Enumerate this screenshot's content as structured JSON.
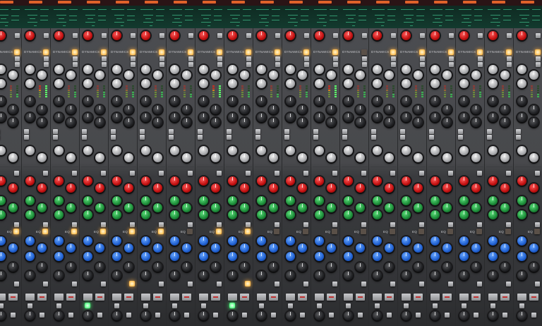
{
  "labels": {
    "dynamics": "DYNAMICS",
    "eq": "EQ"
  },
  "colors": {
    "accent_orange": "#e0622a",
    "display_green": "#3fbf8a",
    "led_amber": "#ffc35a",
    "led_green": "#5cff8a"
  },
  "channels": [
    {
      "dyn_on": true,
      "meter_level": 0.3,
      "eq_on": true,
      "sel_on": false,
      "aux_on": false
    },
    {
      "dyn_on": true,
      "meter_level": 1.0,
      "eq_on": true,
      "sel_on": false,
      "aux_on": false
    },
    {
      "dyn_on": true,
      "meter_level": 0.4,
      "eq_on": true,
      "sel_on": false,
      "aux_on": false
    },
    {
      "dyn_on": true,
      "meter_level": 0.5,
      "eq_on": true,
      "sel_on": true,
      "aux_on": false
    },
    {
      "dyn_on": true,
      "meter_level": 0.4,
      "eq_on": true,
      "sel_on": false,
      "aux_on": true
    },
    {
      "dyn_on": true,
      "meter_level": 0.5,
      "eq_on": true,
      "sel_on": false,
      "aux_on": false
    },
    {
      "dyn_on": true,
      "meter_level": 0.3,
      "eq_on": false,
      "sel_on": false,
      "aux_on": false
    },
    {
      "dyn_on": true,
      "meter_level": 1.0,
      "eq_on": true,
      "sel_on": false,
      "aux_on": false
    },
    {
      "dyn_on": true,
      "meter_level": 0.4,
      "eq_on": true,
      "sel_on": true,
      "aux_on": true
    },
    {
      "dyn_on": true,
      "meter_level": 0.3,
      "eq_on": false,
      "sel_on": false,
      "aux_on": false
    },
    {
      "dyn_on": true,
      "meter_level": 0.5,
      "eq_on": false,
      "sel_on": false,
      "aux_on": false
    },
    {
      "dyn_on": true,
      "meter_level": 0.9,
      "eq_on": false,
      "sel_on": false,
      "aux_on": false
    },
    {
      "dyn_on": false,
      "meter_level": 0.4,
      "eq_on": false,
      "sel_on": false,
      "aux_on": false
    },
    {
      "dyn_on": true,
      "meter_level": 0.3,
      "eq_on": false,
      "sel_on": false,
      "aux_on": false
    },
    {
      "dyn_on": true,
      "meter_level": 0.5,
      "eq_on": false,
      "sel_on": false,
      "aux_on": false
    },
    {
      "dyn_on": true,
      "meter_level": 0.3,
      "eq_on": false,
      "sel_on": false,
      "aux_on": false
    },
    {
      "dyn_on": true,
      "meter_level": 0.4,
      "eq_on": false,
      "sel_on": false,
      "aux_on": false
    },
    {
      "dyn_on": true,
      "meter_level": 0.5,
      "eq_on": false,
      "sel_on": false,
      "aux_on": false
    },
    {
      "dyn_on": true,
      "meter_level": 0.3,
      "eq_on": false,
      "sel_on": false,
      "aux_on": false
    }
  ]
}
